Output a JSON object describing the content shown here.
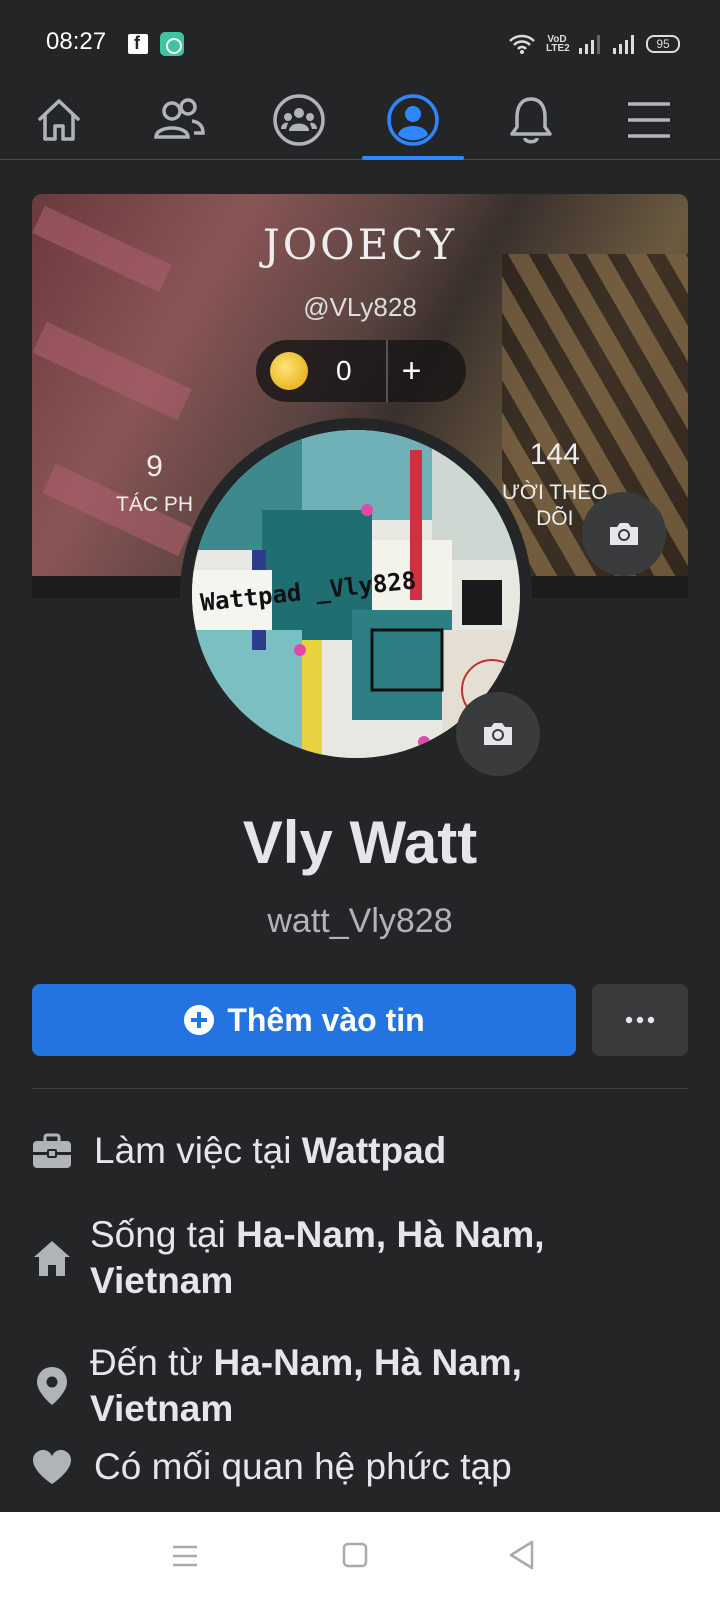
{
  "status_bar": {
    "time": "08:27",
    "network_label_top": "VoD",
    "network_label_bottom": "LTE2",
    "battery": "95"
  },
  "nav": {
    "items": [
      {
        "name": "home",
        "icon": "home-icon",
        "active": false
      },
      {
        "name": "friends",
        "icon": "friends-icon",
        "active": false
      },
      {
        "name": "groups",
        "icon": "groups-icon",
        "active": false
      },
      {
        "name": "profile",
        "icon": "profile-icon",
        "active": true
      },
      {
        "name": "notifications",
        "icon": "bell-icon",
        "active": false
      },
      {
        "name": "menu",
        "icon": "hamburger-menu-icon",
        "active": false
      }
    ],
    "active_color": "#2d88ff"
  },
  "cover": {
    "name": "JOOECY",
    "handle": "@VLy828",
    "coin_count": "0",
    "coin_plus": "+",
    "stat_left_num": "9",
    "stat_left_label": "TÁC PH",
    "stat_right_num": "144",
    "stat_right_label_1": "ƯỜI THEO",
    "stat_right_label_2": "DÕI"
  },
  "avatar": {
    "text": "Wattpad _Vly828"
  },
  "profile": {
    "name": "Vly Watt",
    "username": "watt_Vly828"
  },
  "actions": {
    "add_story": "Thêm vào tin",
    "more": "···",
    "primary_color": "#2374e1"
  },
  "info": {
    "work_prefix": "Làm việc tại ",
    "work_value": "Wattpad",
    "lives_prefix": "Sống tại ",
    "lives_value_1": "Ha-Nam, Hà Nam,",
    "lives_value_2": "Vietnam",
    "from_prefix": "Đến từ ",
    "from_value_1": "Ha-Nam, Hà Nam,",
    "from_value_2": "Vietnam",
    "relationship": "Có mối quan hệ phức tạp"
  }
}
